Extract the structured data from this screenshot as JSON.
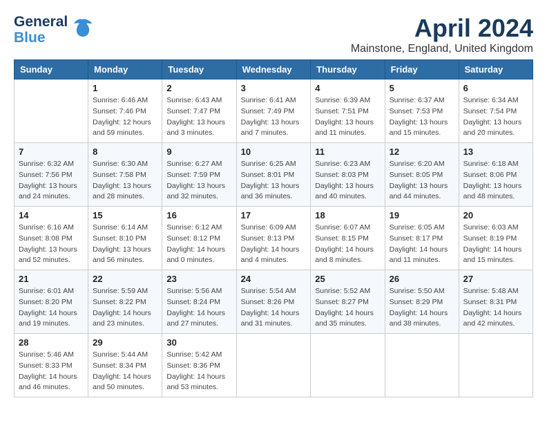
{
  "header": {
    "logo_general": "General",
    "logo_blue": "Blue",
    "month_title": "April 2024",
    "location": "Mainstone, England, United Kingdom"
  },
  "days_of_week": [
    "Sunday",
    "Monday",
    "Tuesday",
    "Wednesday",
    "Thursday",
    "Friday",
    "Saturday"
  ],
  "weeks": [
    [
      {
        "date": "",
        "sunrise": "",
        "sunset": "",
        "daylight": ""
      },
      {
        "date": "1",
        "sunrise": "Sunrise: 6:46 AM",
        "sunset": "Sunset: 7:46 PM",
        "daylight": "Daylight: 12 hours and 59 minutes."
      },
      {
        "date": "2",
        "sunrise": "Sunrise: 6:43 AM",
        "sunset": "Sunset: 7:47 PM",
        "daylight": "Daylight: 13 hours and 3 minutes."
      },
      {
        "date": "3",
        "sunrise": "Sunrise: 6:41 AM",
        "sunset": "Sunset: 7:49 PM",
        "daylight": "Daylight: 13 hours and 7 minutes."
      },
      {
        "date": "4",
        "sunrise": "Sunrise: 6:39 AM",
        "sunset": "Sunset: 7:51 PM",
        "daylight": "Daylight: 13 hours and 11 minutes."
      },
      {
        "date": "5",
        "sunrise": "Sunrise: 6:37 AM",
        "sunset": "Sunset: 7:53 PM",
        "daylight": "Daylight: 13 hours and 15 minutes."
      },
      {
        "date": "6",
        "sunrise": "Sunrise: 6:34 AM",
        "sunset": "Sunset: 7:54 PM",
        "daylight": "Daylight: 13 hours and 20 minutes."
      }
    ],
    [
      {
        "date": "7",
        "sunrise": "Sunrise: 6:32 AM",
        "sunset": "Sunset: 7:56 PM",
        "daylight": "Daylight: 13 hours and 24 minutes."
      },
      {
        "date": "8",
        "sunrise": "Sunrise: 6:30 AM",
        "sunset": "Sunset: 7:58 PM",
        "daylight": "Daylight: 13 hours and 28 minutes."
      },
      {
        "date": "9",
        "sunrise": "Sunrise: 6:27 AM",
        "sunset": "Sunset: 7:59 PM",
        "daylight": "Daylight: 13 hours and 32 minutes."
      },
      {
        "date": "10",
        "sunrise": "Sunrise: 6:25 AM",
        "sunset": "Sunset: 8:01 PM",
        "daylight": "Daylight: 13 hours and 36 minutes."
      },
      {
        "date": "11",
        "sunrise": "Sunrise: 6:23 AM",
        "sunset": "Sunset: 8:03 PM",
        "daylight": "Daylight: 13 hours and 40 minutes."
      },
      {
        "date": "12",
        "sunrise": "Sunrise: 6:20 AM",
        "sunset": "Sunset: 8:05 PM",
        "daylight": "Daylight: 13 hours and 44 minutes."
      },
      {
        "date": "13",
        "sunrise": "Sunrise: 6:18 AM",
        "sunset": "Sunset: 8:06 PM",
        "daylight": "Daylight: 13 hours and 48 minutes."
      }
    ],
    [
      {
        "date": "14",
        "sunrise": "Sunrise: 6:16 AM",
        "sunset": "Sunset: 8:08 PM",
        "daylight": "Daylight: 13 hours and 52 minutes."
      },
      {
        "date": "15",
        "sunrise": "Sunrise: 6:14 AM",
        "sunset": "Sunset: 8:10 PM",
        "daylight": "Daylight: 13 hours and 56 minutes."
      },
      {
        "date": "16",
        "sunrise": "Sunrise: 6:12 AM",
        "sunset": "Sunset: 8:12 PM",
        "daylight": "Daylight: 14 hours and 0 minutes."
      },
      {
        "date": "17",
        "sunrise": "Sunrise: 6:09 AM",
        "sunset": "Sunset: 8:13 PM",
        "daylight": "Daylight: 14 hours and 4 minutes."
      },
      {
        "date": "18",
        "sunrise": "Sunrise: 6:07 AM",
        "sunset": "Sunset: 8:15 PM",
        "daylight": "Daylight: 14 hours and 8 minutes."
      },
      {
        "date": "19",
        "sunrise": "Sunrise: 6:05 AM",
        "sunset": "Sunset: 8:17 PM",
        "daylight": "Daylight: 14 hours and 11 minutes."
      },
      {
        "date": "20",
        "sunrise": "Sunrise: 6:03 AM",
        "sunset": "Sunset: 8:19 PM",
        "daylight": "Daylight: 14 hours and 15 minutes."
      }
    ],
    [
      {
        "date": "21",
        "sunrise": "Sunrise: 6:01 AM",
        "sunset": "Sunset: 8:20 PM",
        "daylight": "Daylight: 14 hours and 19 minutes."
      },
      {
        "date": "22",
        "sunrise": "Sunrise: 5:59 AM",
        "sunset": "Sunset: 8:22 PM",
        "daylight": "Daylight: 14 hours and 23 minutes."
      },
      {
        "date": "23",
        "sunrise": "Sunrise: 5:56 AM",
        "sunset": "Sunset: 8:24 PM",
        "daylight": "Daylight: 14 hours and 27 minutes."
      },
      {
        "date": "24",
        "sunrise": "Sunrise: 5:54 AM",
        "sunset": "Sunset: 8:26 PM",
        "daylight": "Daylight: 14 hours and 31 minutes."
      },
      {
        "date": "25",
        "sunrise": "Sunrise: 5:52 AM",
        "sunset": "Sunset: 8:27 PM",
        "daylight": "Daylight: 14 hours and 35 minutes."
      },
      {
        "date": "26",
        "sunrise": "Sunrise: 5:50 AM",
        "sunset": "Sunset: 8:29 PM",
        "daylight": "Daylight: 14 hours and 38 minutes."
      },
      {
        "date": "27",
        "sunrise": "Sunrise: 5:48 AM",
        "sunset": "Sunset: 8:31 PM",
        "daylight": "Daylight: 14 hours and 42 minutes."
      }
    ],
    [
      {
        "date": "28",
        "sunrise": "Sunrise: 5:46 AM",
        "sunset": "Sunset: 8:33 PM",
        "daylight": "Daylight: 14 hours and 46 minutes."
      },
      {
        "date": "29",
        "sunrise": "Sunrise: 5:44 AM",
        "sunset": "Sunset: 8:34 PM",
        "daylight": "Daylight: 14 hours and 50 minutes."
      },
      {
        "date": "30",
        "sunrise": "Sunrise: 5:42 AM",
        "sunset": "Sunset: 8:36 PM",
        "daylight": "Daylight: 14 hours and 53 minutes."
      },
      {
        "date": "",
        "sunrise": "",
        "sunset": "",
        "daylight": ""
      },
      {
        "date": "",
        "sunrise": "",
        "sunset": "",
        "daylight": ""
      },
      {
        "date": "",
        "sunrise": "",
        "sunset": "",
        "daylight": ""
      },
      {
        "date": "",
        "sunrise": "",
        "sunset": "",
        "daylight": ""
      }
    ]
  ]
}
